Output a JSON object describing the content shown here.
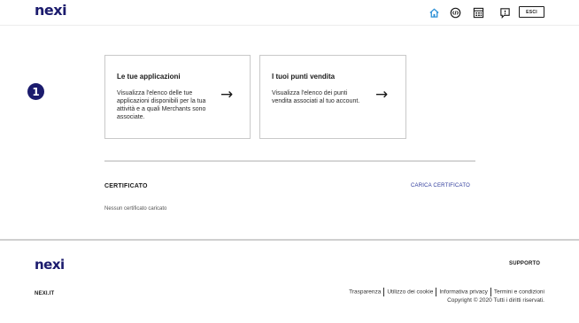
{
  "header": {
    "logo": "nexi",
    "icons": [
      "home-icon",
      "developer-icon",
      "calculator-icon",
      "help-icon"
    ],
    "esci_label": "ESCI"
  },
  "step_badge": "1",
  "cards": [
    {
      "title": "Le tue applicazioni",
      "description": "Visualizza l'elenco delle tue applicazioni disponibili per la tua attività e a quali Merchants sono associate.",
      "arrow": "→"
    },
    {
      "title": "I tuoi punti vendita",
      "description": "Visualizza l'elenco dei punti vendita associati al tuo account.",
      "arrow": "→"
    }
  ],
  "certificate": {
    "title": "CERTIFICATO",
    "upload_link": "CARICA CERTIFICATO",
    "empty_text": "Nessun certificato caricato"
  },
  "footer": {
    "logo": "nexi",
    "support": "SUPPORTO",
    "site": "NEXI.IT",
    "links": [
      "Trasparenza",
      "Utilizzo dei cookie",
      "Informativa privacy",
      "Termini e condizioni"
    ],
    "copyright": "Copyright © 2020 Tutti i diritti riservati."
  },
  "colors": {
    "brand": "#1b1b6d",
    "link": "#2e3a9b",
    "home_icon": "#2a8fd6"
  }
}
